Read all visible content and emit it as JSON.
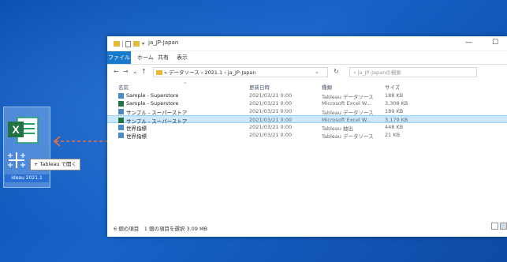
{
  "desktop": {
    "drag_badge": "+ Tableau で開く",
    "file_caption": "ideau 2021.1"
  },
  "window": {
    "title": "ja_JP-Japan",
    "minimize": "—",
    "maximize": "☐"
  },
  "ribbon": {
    "tabs": [
      "ファイル",
      "ホーム",
      "共有",
      "表示"
    ]
  },
  "address": {
    "back": "←",
    "forward": "→",
    "recent": "⌄",
    "up": "↑",
    "path": "« データソース › 2021.1 › ja_JP-Japan",
    "dropdown": "⌄",
    "refresh": "↻",
    "search_placeholder": "ja_JP-Japanの検索"
  },
  "columns": {
    "sort_arrow": "^",
    "name": "名前",
    "date": "更新日時",
    "type": "種類",
    "size": "サイズ"
  },
  "files": [
    {
      "name": "Sample - Superstore",
      "date": "2021/03/21 0:00",
      "type": "Tableau データソース",
      "size": "188 KB",
      "icon": "tableau-data-icon",
      "color": "#4a8bc4",
      "selected": false
    },
    {
      "name": "Sample - Superstore",
      "date": "2021/03/21 0:00",
      "type": "Microsoft Excel W...",
      "size": "3,308 KB",
      "icon": "excel-file-icon",
      "color": "#217346",
      "selected": false
    },
    {
      "name": "サンプル - スーパーストア",
      "date": "2021/03/21 0:00",
      "type": "Tableau データソース",
      "size": "189 KB",
      "icon": "tableau-data-icon",
      "color": "#4a8bc4",
      "selected": false
    },
    {
      "name": "サンプル - スーパーストア",
      "date": "2021/03/21 0:00",
      "type": "Microsoft Excel W...",
      "size": "3,179 KB",
      "icon": "excel-file-icon",
      "color": "#217346",
      "selected": true
    },
    {
      "name": "世界指標",
      "date": "2021/03/21 0:00",
      "type": "Tableau 抽出",
      "size": "448 KB",
      "icon": "tableau-extract-icon",
      "color": "#4a8bc4",
      "selected": false
    },
    {
      "name": "世界指標",
      "date": "2021/03/21 0:00",
      "type": "Tableau データソース",
      "size": "21 KB",
      "icon": "tableau-data-icon",
      "color": "#4a8bc4",
      "selected": false
    }
  ],
  "status": {
    "text": "6 個の項目　1 個の項目を選択 3.09 MB"
  },
  "colors": {
    "accent": "#1979ca",
    "selection": "#cce8ff",
    "arrow": "#e8703a"
  }
}
